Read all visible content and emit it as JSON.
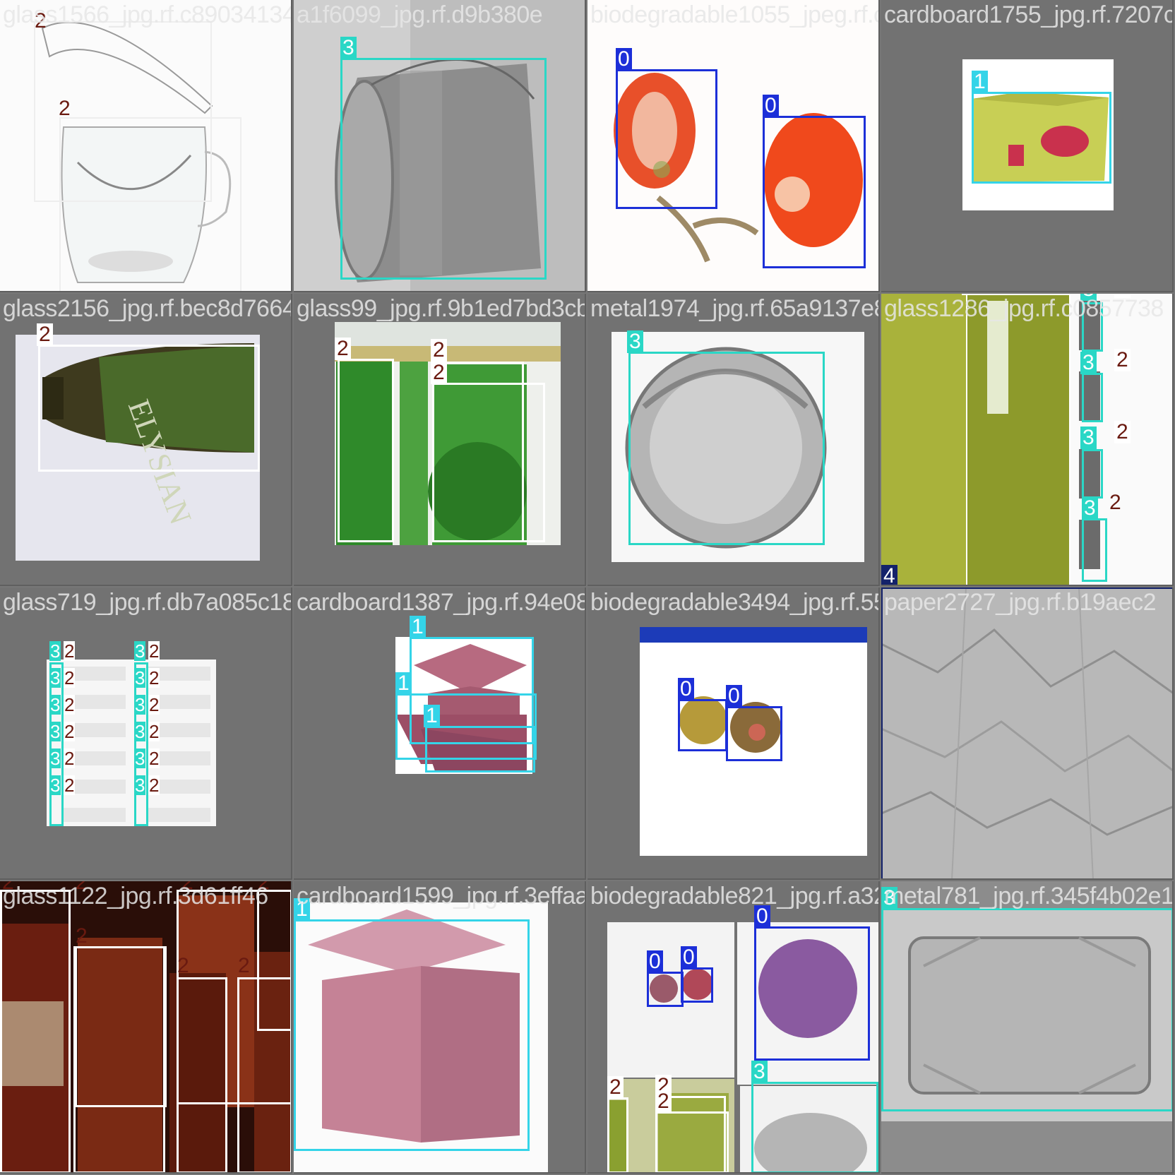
{
  "mosaic": {
    "class_colors": {
      "0": "#1c2fd8",
      "1": "#34d4e8",
      "2": "#ffffff",
      "3": "#2ad7c6",
      "4": "#14226a"
    },
    "tiles": [
      {
        "filename": "glass1566_jpg.rf.c89034134",
        "labels": [
          "2",
          "2"
        ]
      },
      {
        "filename": "a1f6099_jpg.rf.d9b380e",
        "labels": [
          "3"
        ]
      },
      {
        "filename": "biodegradable1055_jpeg.rf.c",
        "labels": [
          "0",
          "0"
        ]
      },
      {
        "filename": "cardboard1755_jpg.rf.7207c1",
        "labels": [
          "1"
        ]
      },
      {
        "filename": "glass2156_jpg.rf.bec8d7664",
        "labels": [
          "2"
        ]
      },
      {
        "filename": "glass99_jpg.rf.9b1ed7bd3cb0",
        "labels": [
          "2",
          "2",
          "2"
        ]
      },
      {
        "filename": "metal1974_jpg.rf.65a9137e87b",
        "labels": [
          "3"
        ]
      },
      {
        "filename": "glass1286_jpg.rf.c0857738",
        "labels": [
          "2",
          "3",
          "2",
          "3",
          "2",
          "3",
          "2",
          "3",
          "2",
          "4"
        ]
      },
      {
        "filename": "glass719_jpg.rf.db7a085c18",
        "labels": [
          "3",
          "2",
          "3",
          "2",
          "3",
          "2",
          "3",
          "2",
          "3",
          "2",
          "3",
          "2",
          "3",
          "2",
          "3",
          "2",
          "3",
          "2",
          "3",
          "2",
          "3",
          "2",
          "3",
          "2"
        ]
      },
      {
        "filename": "cardboard1387_jpg.rf.94e08c",
        "labels": [
          "1",
          "1",
          "1"
        ]
      },
      {
        "filename": "biodegradable3494_jpg.rf.55",
        "labels": [
          "0",
          "0"
        ]
      },
      {
        "filename": "paper2727_jpg.rf.b19aec2",
        "labels": []
      },
      {
        "filename": "glass1122_jpg.rf.3d61ff46",
        "labels": [
          "2",
          "2",
          "2",
          "2",
          "2",
          "2",
          "2"
        ]
      },
      {
        "filename": "cardboard1599_jpg.rf.3effaa",
        "labels": [
          "1"
        ]
      },
      {
        "filename": "biodegradable821_jpg.rf.a32",
        "labels": [
          "0",
          "0",
          "0",
          "3",
          "2",
          "2",
          "2"
        ]
      },
      {
        "filename": "metal781_jpg.rf.345f4b02e1",
        "labels": [
          "3"
        ]
      }
    ]
  }
}
